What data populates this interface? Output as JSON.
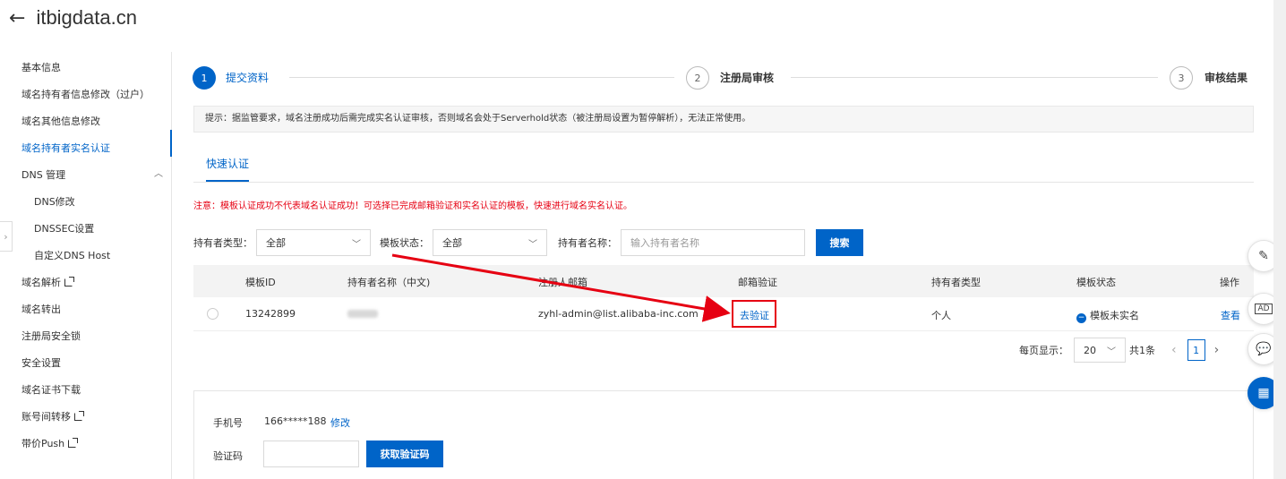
{
  "header": {
    "title": "itbigdata.cn"
  },
  "sidebar": {
    "items": [
      {
        "label": "基本信息"
      },
      {
        "label": "域名持有者信息修改（过户）"
      },
      {
        "label": "域名其他信息修改"
      },
      {
        "label": "域名持有者实名认证"
      },
      {
        "label": "DNS 管理"
      },
      {
        "label": "DNS修改"
      },
      {
        "label": "DNSSEC设置"
      },
      {
        "label": "自定义DNS Host"
      },
      {
        "label": "域名解析"
      },
      {
        "label": "域名转出"
      },
      {
        "label": "注册局安全锁"
      },
      {
        "label": "安全设置"
      },
      {
        "label": "域名证书下载"
      },
      {
        "label": "账号间转移"
      },
      {
        "label": "带价Push"
      }
    ]
  },
  "steps": [
    {
      "num": "1",
      "label": "提交资料"
    },
    {
      "num": "2",
      "label": "注册局审核"
    },
    {
      "num": "3",
      "label": "审核结果"
    }
  ],
  "tip": "提示：据监管要求，域名注册成功后需完成实名认证审核，否则域名会处于Serverhold状态（被注册局设置为暂停解析），无法正常使用。",
  "tab": "快速认证",
  "notice": "注意：模板认证成功不代表域名认证成功！可选择已完成邮箱验证和实名认证的模板，快速进行域名实名认证。",
  "filters": {
    "holder_type_label": "持有者类型：",
    "holder_type_value": "全部",
    "template_status_label": "模板状态：",
    "template_status_value": "全部",
    "holder_name_label": "持有者名称：",
    "holder_name_placeholder": "输入持有者名称",
    "search": "搜索"
  },
  "table": {
    "headers": [
      "模板ID",
      "持有者名称（中文)",
      "注册人邮箱",
      "邮箱验证",
      "持有者类型",
      "模板状态",
      "操作"
    ],
    "rows": [
      {
        "id": "13242899",
        "email": "zyhl-admin@list.alibaba-inc.com",
        "verify": "去验证",
        "holder_type": "个人",
        "status": "模板未实名",
        "action": "查看"
      }
    ]
  },
  "pager": {
    "page_size_label": "每页显示：",
    "page_size": "20",
    "total": "共1条",
    "current_page": "1"
  },
  "phone": {
    "label": "手机号",
    "value": "166*****188",
    "modify": "修改"
  },
  "code": {
    "label": "验证码",
    "button": "获取验证码"
  },
  "colors": {
    "primary": "#0064c8",
    "warning": "#e60012"
  }
}
